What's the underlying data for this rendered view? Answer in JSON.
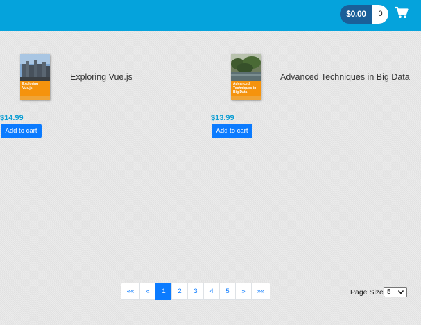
{
  "header": {
    "cart_total": "$0.00",
    "cart_count": "0",
    "cart_icon": "shopping-cart-icon"
  },
  "products": [
    {
      "title": "Exploring Vue.js",
      "price": "$14.99",
      "add_label": "Add to cart",
      "cover_text": "Exploring Vue.js"
    },
    {
      "title": "Advanced Techniques in Big Data",
      "price": "$13.99",
      "add_label": "Add to cart",
      "cover_text": "Advanced Techniques in Big Data"
    }
  ],
  "pagination": {
    "first_label": "««",
    "prev_label": "«",
    "pages": [
      "1",
      "2",
      "3",
      "4",
      "5"
    ],
    "active_page": "1",
    "next_label": "»",
    "last_label": "»»"
  },
  "page_size": {
    "label": "Page Size",
    "value": "5"
  },
  "colors": {
    "header": "#05a3dc",
    "accent": "#0b7bff",
    "price": "#0d9ed3",
    "book_band": "#f5930d"
  }
}
